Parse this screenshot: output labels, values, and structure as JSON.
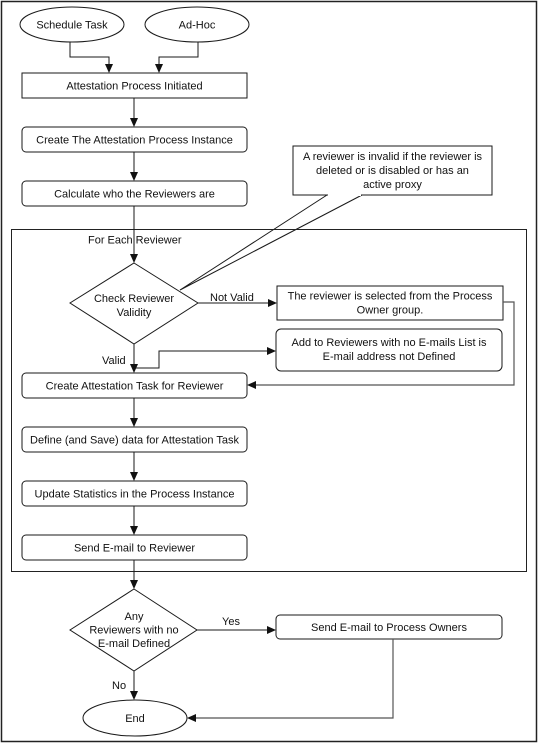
{
  "diagram": {
    "start_events": [
      {
        "id": "schedule",
        "label": "Schedule Task"
      },
      {
        "id": "adhoc",
        "label": "Ad-Hoc"
      }
    ],
    "steps": {
      "initiated": "Attestation Process Initiated",
      "create_instance": "Create The Attestation Process Instance",
      "calculate": "Calculate who the Reviewers are",
      "create_task": "Create Attestation Task for Reviewer",
      "define_data": "Define (and Save) data for Attestation Task",
      "update_stats": "Update Statistics in the Process Instance",
      "send_reviewer": "Send E-mail to Reviewer",
      "send_owners": "Send E-mail to Process Owners",
      "end": "End"
    },
    "loop_label": "For Each Reviewer",
    "decisions": {
      "validity": [
        "Check Reviewer",
        "Validity"
      ],
      "no_email": [
        "Any",
        "Reviewers with no",
        "E-mail Defined"
      ]
    },
    "edge_labels": {
      "not_valid": "Not Valid",
      "valid": "Valid",
      "yes": "Yes",
      "no": "No"
    },
    "notes": {
      "invalid_callout": [
        "A reviewer is invalid if the reviewer is",
        "deleted or is disabled or has an",
        "active proxy"
      ],
      "process_owner": [
        "The reviewer is selected from the Process",
        "Owner group."
      ],
      "no_email_list": [
        "Add to Reviewers with no E-mails List is",
        "E-mail address not Defined"
      ]
    }
  }
}
